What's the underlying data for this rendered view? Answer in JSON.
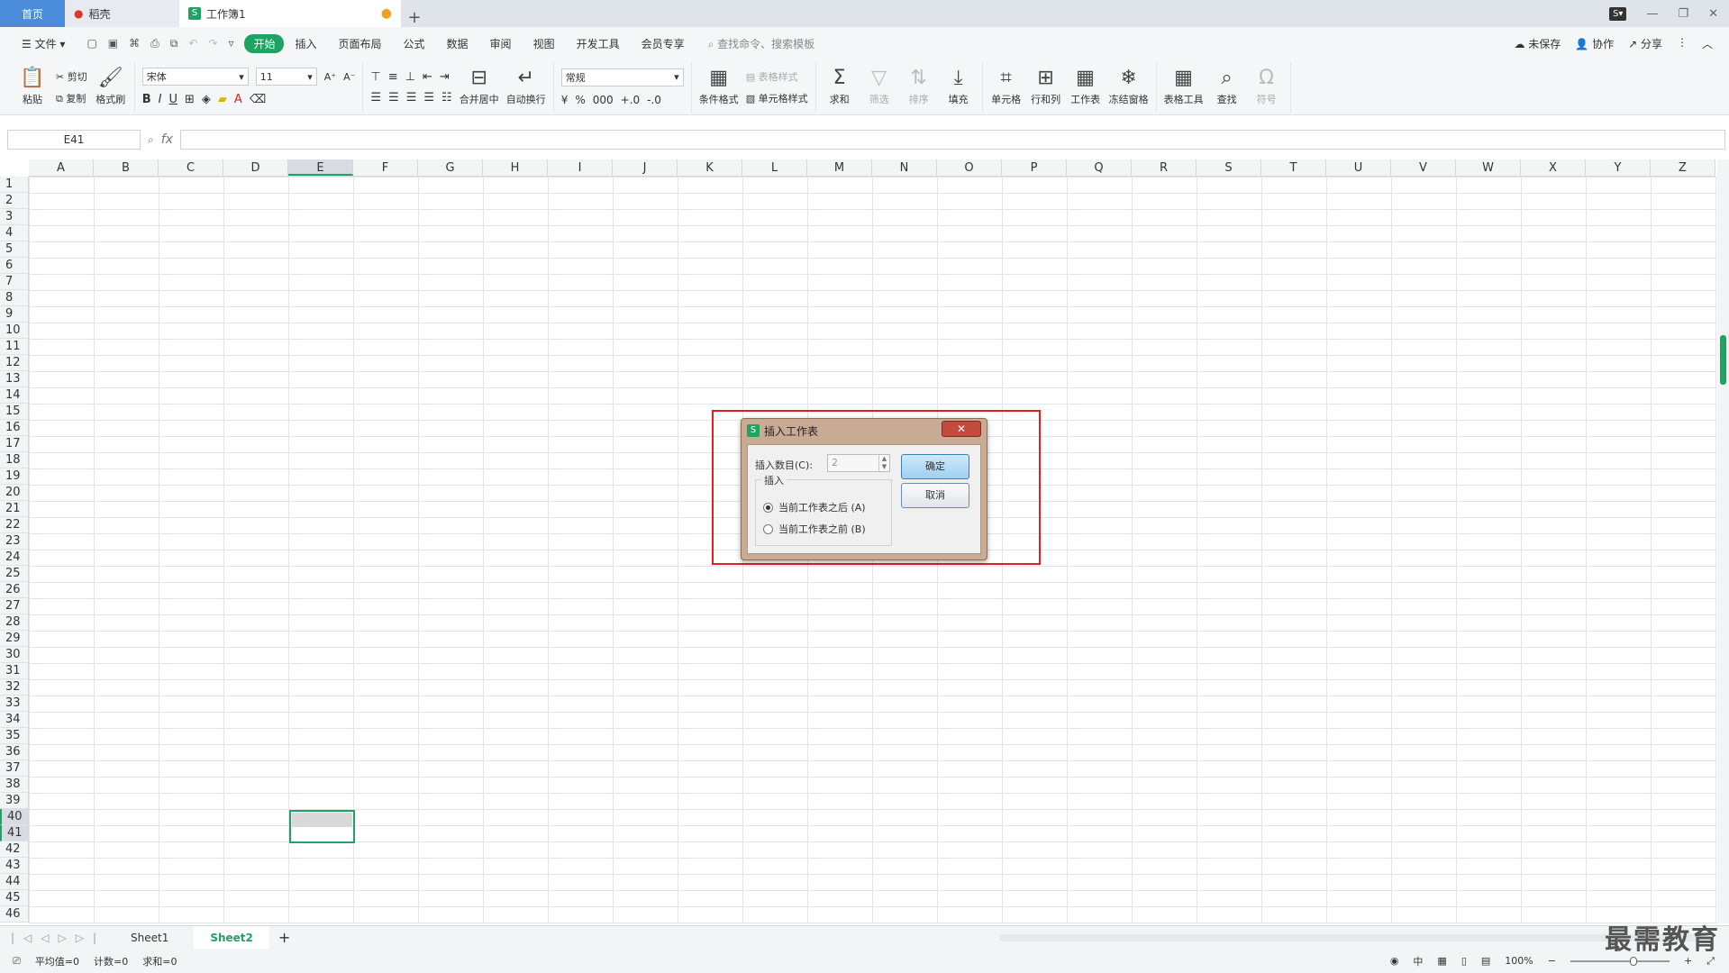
{
  "tabs": {
    "home": "首页",
    "daoke": "稻壳",
    "workbook": "工作簿1",
    "new": "+"
  },
  "menu": {
    "file": "文件",
    "items": [
      "开始",
      "插入",
      "页面布局",
      "公式",
      "数据",
      "审阅",
      "视图",
      "开发工具",
      "会员专享"
    ],
    "search_placeholder": "查找命令、搜索模板",
    "unsaved": "未保存",
    "collab": "协作",
    "share": "分享"
  },
  "ribbon": {
    "paste": "粘贴",
    "cut": "剪切",
    "copy": "复制",
    "format_painter": "格式刷",
    "font": "宋体",
    "font_size": "11",
    "merge": "合并居中",
    "wrap": "自动换行",
    "numfmt": "常规",
    "cond_format": "条件格式",
    "table_style": "表格样式",
    "cell_style": "单元格样式",
    "sum": "求和",
    "filter": "筛选",
    "sort": "排序",
    "fill": "填充",
    "cell": "单元格",
    "rowcol": "行和列",
    "worksheet": "工作表",
    "freeze": "冻结窗格",
    "table_tools": "表格工具",
    "find": "查找",
    "symbol": "符号"
  },
  "formula": {
    "namebox": "E41",
    "fx": "fx"
  },
  "columns": [
    "A",
    "B",
    "C",
    "D",
    "E",
    "F",
    "G",
    "H",
    "I",
    "J",
    "K",
    "L",
    "M",
    "N",
    "O",
    "P",
    "Q",
    "R",
    "S",
    "T",
    "U",
    "V",
    "W",
    "X",
    "Y",
    "Z"
  ],
  "rows": [
    "1",
    "2",
    "3",
    "4",
    "5",
    "6",
    "7",
    "8",
    "9",
    "10",
    "11",
    "12",
    "13",
    "14",
    "15",
    "16",
    "17",
    "18",
    "19",
    "20",
    "21",
    "22",
    "23",
    "24",
    "25",
    "26",
    "27",
    "28",
    "29",
    "30",
    "31",
    "32",
    "33",
    "34",
    "35",
    "36",
    "37",
    "38",
    "39",
    "40",
    "41",
    "42",
    "43",
    "44",
    "45",
    "46"
  ],
  "sheets": {
    "sheet1": "Sheet1",
    "sheet2": "Sheet2",
    "add": "+"
  },
  "status": {
    "avg": "平均值=0",
    "count": "计数=0",
    "sum": "求和=0",
    "zoom": "100%"
  },
  "dialog": {
    "title": "插入工作表",
    "count_label": "插入数目(C):",
    "count_value": "2",
    "group_label": "插入",
    "after": "当前工作表之后 (A)",
    "before": "当前工作表之前 (B)",
    "ok": "确定",
    "cancel": "取消",
    "close": "✕"
  },
  "watermark": "最需教育",
  "colors": {
    "accent": "#1ea362",
    "highlight": "#e02020"
  }
}
